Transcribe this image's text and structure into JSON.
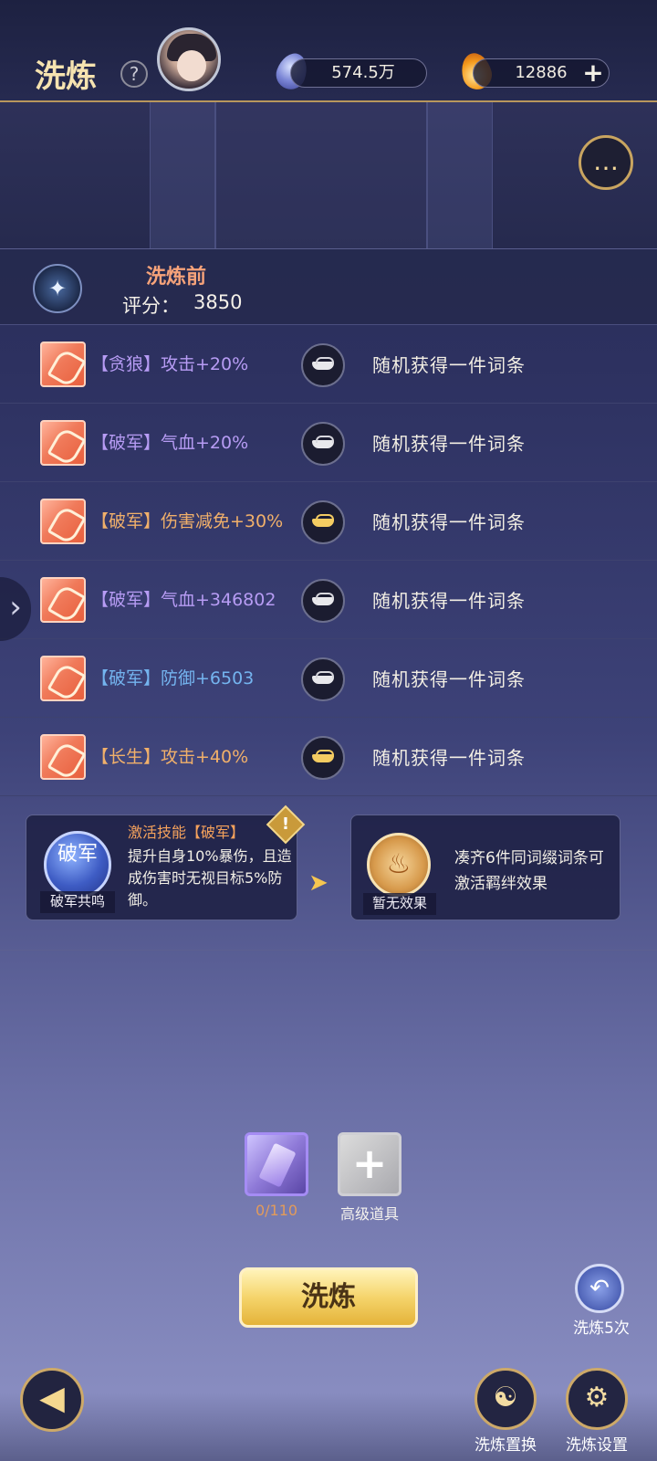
{
  "header": {
    "title": "洗炼",
    "help_icon": "?",
    "jade_amount": "574.5万",
    "fire_amount": "12886",
    "plus_label": "+"
  },
  "chat_icon": "…",
  "before": {
    "title": "洗炼前",
    "score_label": "评分：",
    "score_value": "3850"
  },
  "attributes": [
    {
      "text": "【贪狼】攻击+20%",
      "color": "purple",
      "lock": "silver",
      "result": "随机获得一件词条"
    },
    {
      "text": "【破军】气血+20%",
      "color": "purple",
      "lock": "silver",
      "result": "随机获得一件词条"
    },
    {
      "text": "【破军】伤害减免+30%",
      "color": "orange",
      "lock": "gold",
      "result": "随机获得一件词条"
    },
    {
      "text": "【破军】气血+346802",
      "color": "purple",
      "lock": "silver",
      "result": "随机获得一件词条"
    },
    {
      "text": "【破军】防御+6503",
      "color": "blue",
      "lock": "silver",
      "result": "随机获得一件词条"
    },
    {
      "text": "【长生】攻击+40%",
      "color": "orange",
      "lock": "gold",
      "result": "随机获得一件词条"
    }
  ],
  "skill": {
    "emblem": "破军",
    "emblem_label": "破军共鸣",
    "title": "激活技能【破军】",
    "desc": "提升自身10%暴伤，且造成伤害时无视目标5%防御。",
    "warn": "!"
  },
  "effect": {
    "emblem_label": "暂无效果",
    "text": "凑齐6件同词缀词条可激活羁绊效果"
  },
  "items": {
    "crystal_count": "0/110",
    "add_label": "高级道具",
    "add_icon": "+"
  },
  "main_button": "洗炼",
  "revert": {
    "label": "洗炼5次"
  },
  "bottom": {
    "swap_label": "洗炼置换",
    "settings_label": "洗炼设置"
  },
  "icons": {
    "back": "arrow-left-icon",
    "swap": "swap-icon",
    "settings": "gear-icon",
    "revert": "undo-icon",
    "chat": "chat-bubble-icon",
    "side": "chevron-right-icon"
  },
  "colors": {
    "accent_gold": "#f5d46b",
    "attr_purple": "#b79cf4",
    "attr_orange": "#f1b06a",
    "attr_blue": "#74b4ef"
  }
}
